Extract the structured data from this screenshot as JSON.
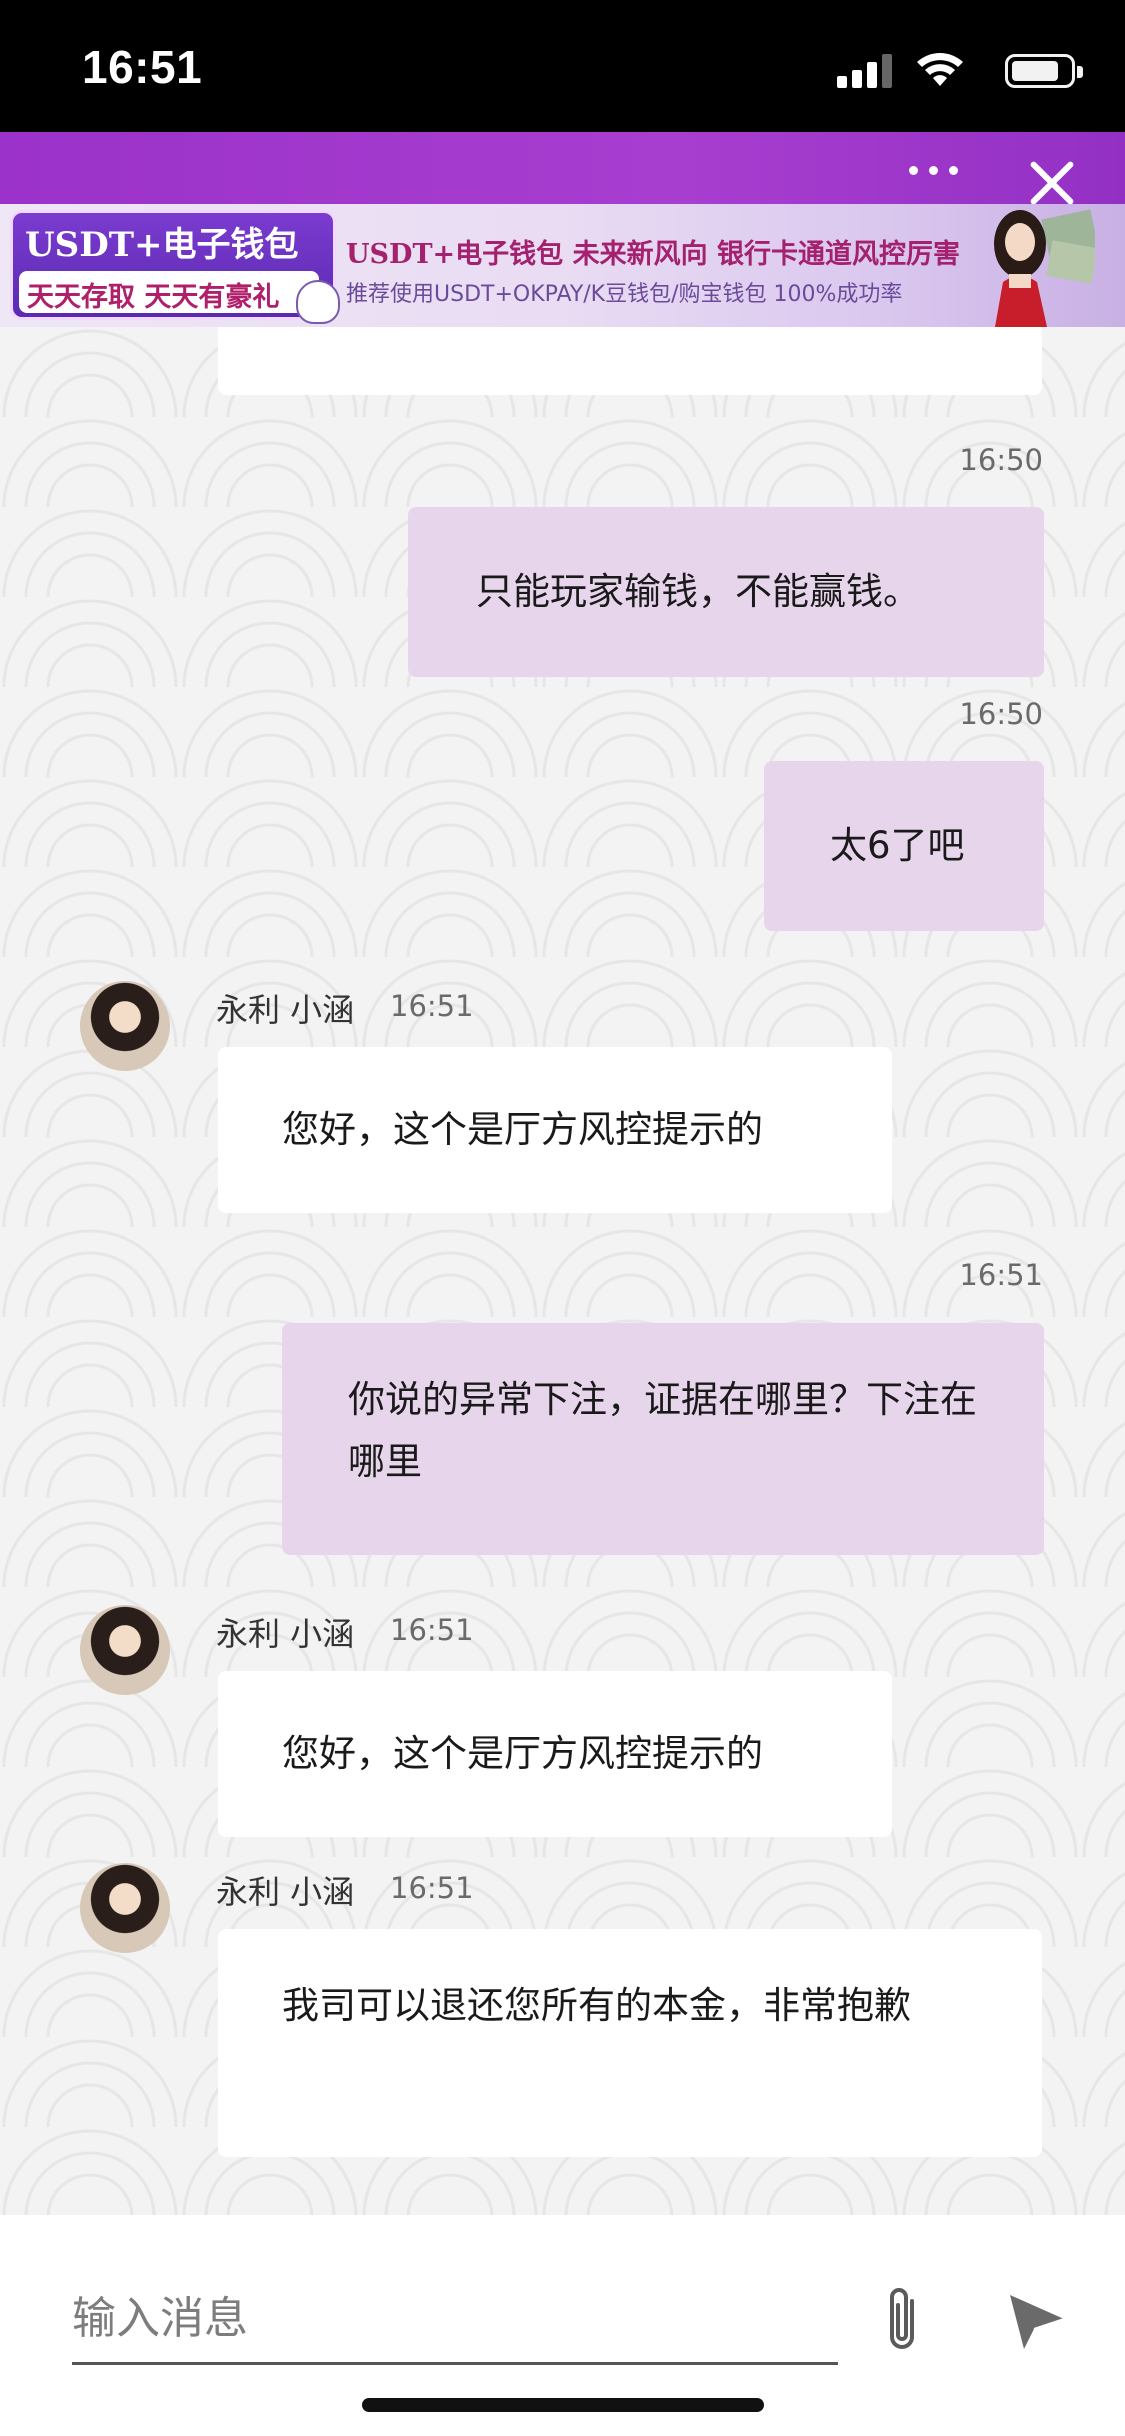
{
  "status_bar": {
    "time": "16:51"
  },
  "header": {
    "more_label": "more",
    "close_label": "close"
  },
  "ad_banner": {
    "left_title": "USDT+电子钱包",
    "left_subtitle": "天天存取 天天有豪礼",
    "main_title": "USDT+电子钱包  未来新风向  银行卡通道风控厉害",
    "main_subtitle": "推荐使用USDT+OKPAY/K豆钱包/购宝钱包  100%成功率"
  },
  "messages": [
    {
      "direction": "out",
      "time": "16:50",
      "text": "只能玩家输钱，不能赢钱。"
    },
    {
      "direction": "out",
      "time": "16:50",
      "text": "太6了吧"
    },
    {
      "direction": "in",
      "sender": "永利 小涵",
      "time": "16:51",
      "text": "您好，这个是厅方风控提示的"
    },
    {
      "direction": "out",
      "time": "16:51",
      "text": "你说的异常下注，证据在哪里？下注在哪里"
    },
    {
      "direction": "in",
      "sender": "永利 小涵",
      "time": "16:51",
      "text": "您好，这个是厅方风控提示的"
    },
    {
      "direction": "in",
      "sender": "永利 小涵",
      "time": "16:51",
      "text": "我司可以退还您所有的本金，非常抱歉"
    }
  ],
  "input": {
    "placeholder": "输入消息",
    "value": ""
  },
  "colors": {
    "header": "#9b32c9",
    "bubble_out": "#e7d5ec",
    "bubble_in": "#ffffff"
  },
  "icons": {
    "attach": "paperclip-icon",
    "send": "send-icon",
    "more": "more-dots-icon",
    "close": "close-icon"
  }
}
